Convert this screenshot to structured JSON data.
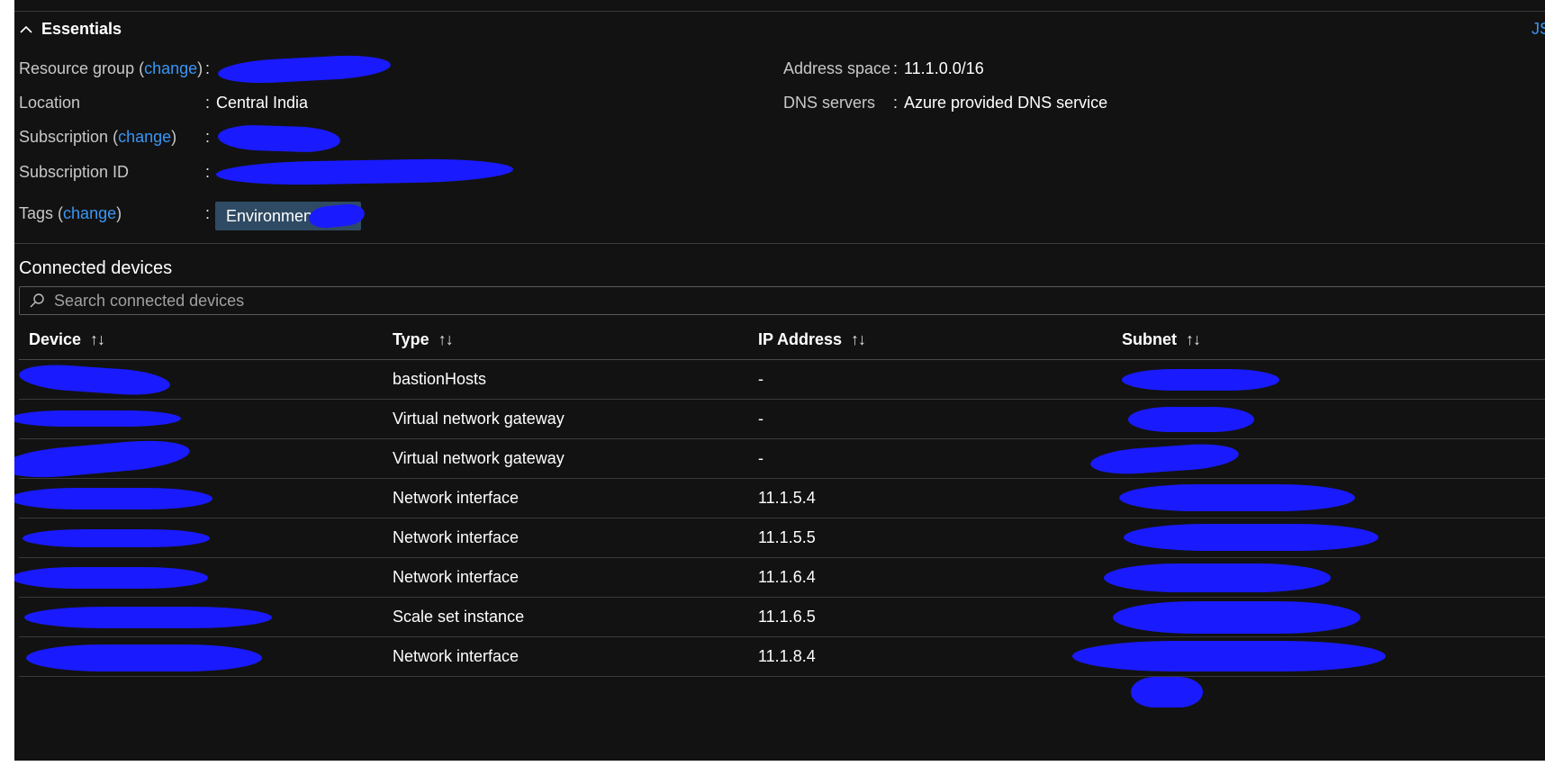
{
  "essentials": {
    "title": "Essentials",
    "json_view": "JS"
  },
  "left_props": {
    "resource_group": {
      "label": "Resource group",
      "change": "change"
    },
    "location": {
      "label": "Location",
      "value": "Central India"
    },
    "subscription": {
      "label": "Subscription",
      "change": "change"
    },
    "subscription_id": {
      "label": "Subscription ID"
    },
    "tags": {
      "label": "Tags",
      "change": "change",
      "chip": "Environment"
    }
  },
  "right_props": {
    "address_space": {
      "label": "Address space",
      "value": "11.1.0.0/16"
    },
    "dns_servers": {
      "label": "DNS servers",
      "value": "Azure provided DNS service"
    }
  },
  "connected_devices": {
    "title": "Connected devices",
    "search_placeholder": "Search connected devices",
    "columns": [
      "Device",
      "Type",
      "IP Address",
      "Subnet"
    ],
    "sort_glyph": "↑↓",
    "rows": [
      {
        "type": "bastionHosts",
        "ip": "-"
      },
      {
        "type": "Virtual network gateway",
        "ip": "-"
      },
      {
        "type": "Virtual network gateway",
        "ip": "-"
      },
      {
        "type": "Network interface",
        "ip": "11.1.5.4"
      },
      {
        "type": "Network interface",
        "ip": "11.1.5.5"
      },
      {
        "type": "Network interface",
        "ip": "11.1.6.4"
      },
      {
        "type": "Scale set instance",
        "ip": "11.1.6.5"
      },
      {
        "type": "Network interface",
        "ip": "11.1.8.4"
      }
    ]
  },
  "colors": {
    "panel_bg": "#121212",
    "link": "#3a96f4",
    "tag_chip": "#2f4a63",
    "redaction": "#1a1aff"
  }
}
